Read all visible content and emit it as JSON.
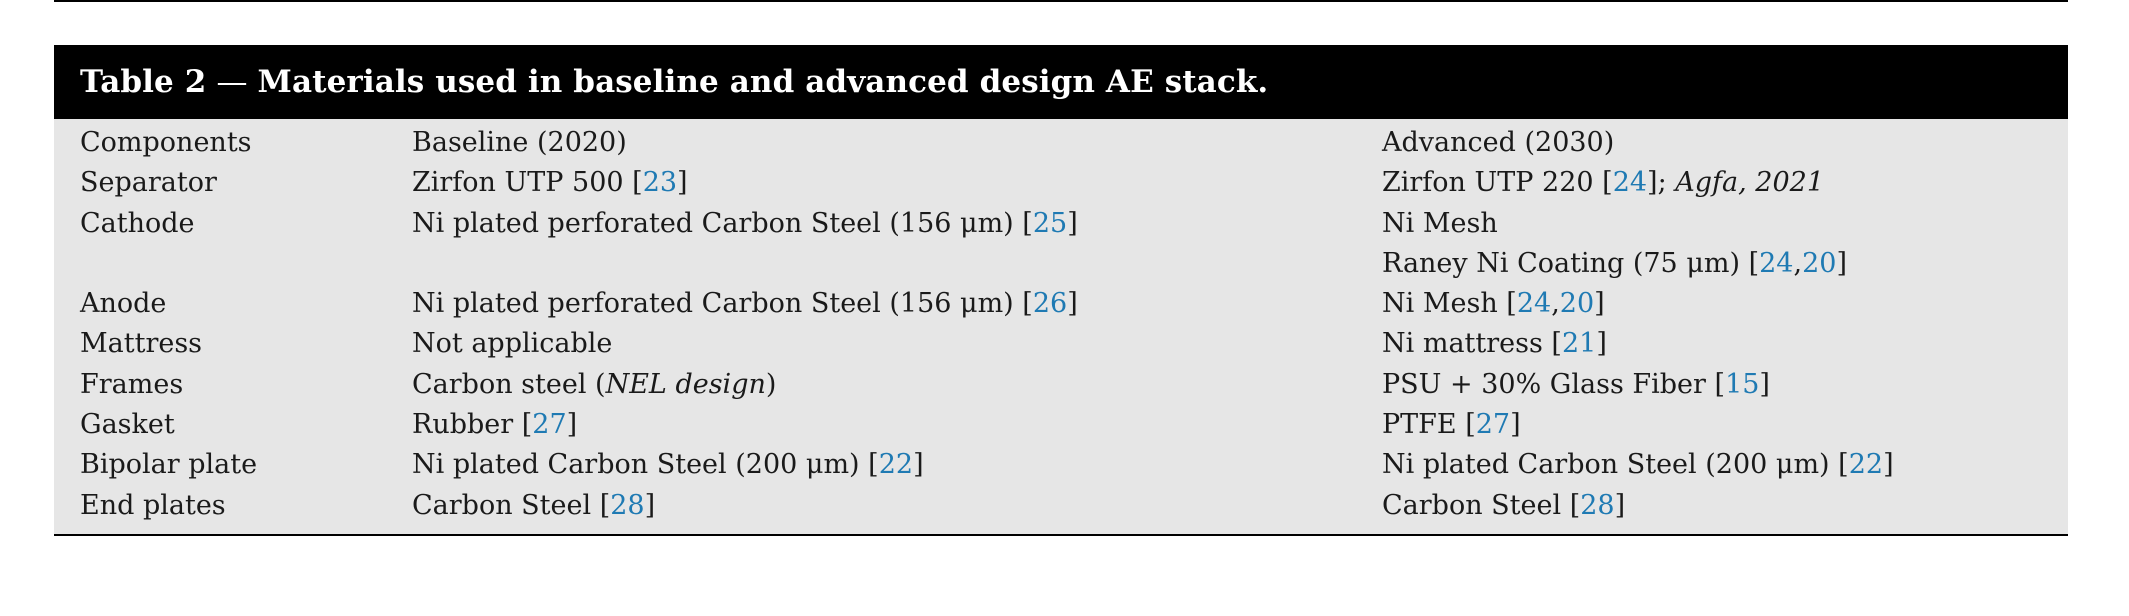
{
  "caption": {
    "label": "Table 2",
    "dash": "—",
    "title": "Materials used in baseline and advanced design AE stack."
  },
  "header": {
    "components": "Components",
    "baseline": "Baseline (2020)",
    "advanced": "Advanced (2030)"
  },
  "rows": [
    {
      "component": "Separator",
      "baseline": {
        "text": "Zirfon UTP 500 [",
        "refs": [
          "23"
        ],
        "tail": "]"
      },
      "advanced": {
        "text": "Zirfon UTP 220 [",
        "refs": [
          "24"
        ],
        "tail": "]; ",
        "italic": "Agfa, 2021"
      }
    },
    {
      "component": "Cathode",
      "baseline": {
        "text": "Ni plated perforated Carbon Steel (156 μm) [",
        "refs": [
          "25"
        ],
        "tail": "]"
      },
      "advanced": {
        "text": "Ni Mesh"
      }
    },
    {
      "component": "",
      "baseline": {
        "text": ""
      },
      "advanced": {
        "text": "Raney Ni Coating (75 μm) [",
        "refs": [
          "24",
          "20"
        ],
        "tail": "]"
      }
    },
    {
      "component": "Anode",
      "baseline": {
        "text": "Ni plated perforated Carbon Steel (156 μm) [",
        "refs": [
          "26"
        ],
        "tail": "]"
      },
      "advanced": {
        "text": "Ni Mesh [",
        "refs": [
          "24",
          "20"
        ],
        "tail": "]"
      }
    },
    {
      "component": "Mattress",
      "baseline": {
        "text": "Not applicable"
      },
      "advanced": {
        "text": "Ni mattress [",
        "refs": [
          "21"
        ],
        "tail": "]"
      }
    },
    {
      "component": "Frames",
      "baseline": {
        "text": "Carbon steel (",
        "italic": "NEL design",
        "tail2": ")"
      },
      "advanced": {
        "text": "PSU + 30% Glass Fiber [",
        "refs": [
          "15"
        ],
        "tail": "]"
      }
    },
    {
      "component": "Gasket",
      "baseline": {
        "text": "Rubber [",
        "refs": [
          "27"
        ],
        "tail": "]"
      },
      "advanced": {
        "text": "PTFE [",
        "refs": [
          "27"
        ],
        "tail": "]"
      }
    },
    {
      "component": "Bipolar plate",
      "baseline": {
        "text": "Ni plated Carbon Steel (200 μm) [",
        "refs": [
          "22"
        ],
        "tail": "]"
      },
      "advanced": {
        "text": "Ni plated Carbon Steel (200 μm) [",
        "refs": [
          "22"
        ],
        "tail": "]"
      }
    },
    {
      "component": "End plates",
      "baseline": {
        "text": "Carbon Steel [",
        "refs": [
          "28"
        ],
        "tail": "]"
      },
      "advanced": {
        "text": "Carbon Steel [",
        "refs": [
          "28"
        ],
        "tail": "]"
      }
    }
  ],
  "colors": {
    "caption_bg": "#000000",
    "table_bg": "#e6e6e6",
    "ref_link": "#1f7ab3"
  }
}
